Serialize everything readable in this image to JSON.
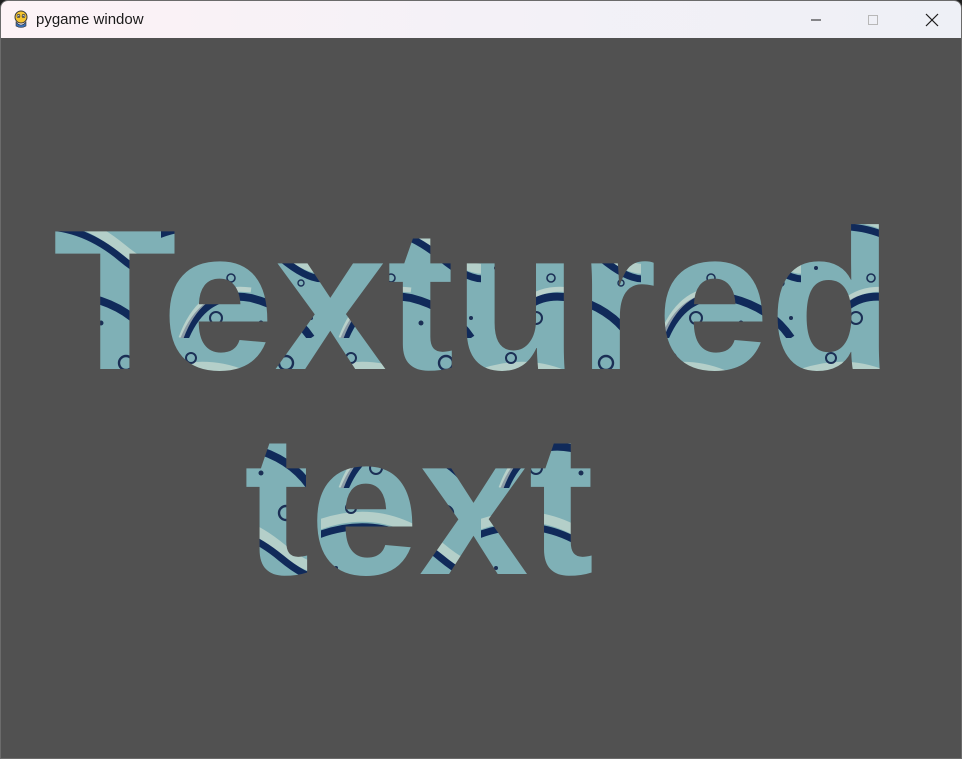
{
  "window": {
    "title": "pygame window",
    "icon": "pygame-snake-icon",
    "controls": [
      "minimize-icon",
      "maximize-icon",
      "close-icon"
    ]
  },
  "canvas": {
    "background": "#515151",
    "line1": "Textured",
    "line2": "text",
    "texture": {
      "name": "water-droplets",
      "base_color": "#7fb0b6",
      "dark_color": "#102a5a",
      "highlight_color": "#dfe8d8"
    }
  }
}
